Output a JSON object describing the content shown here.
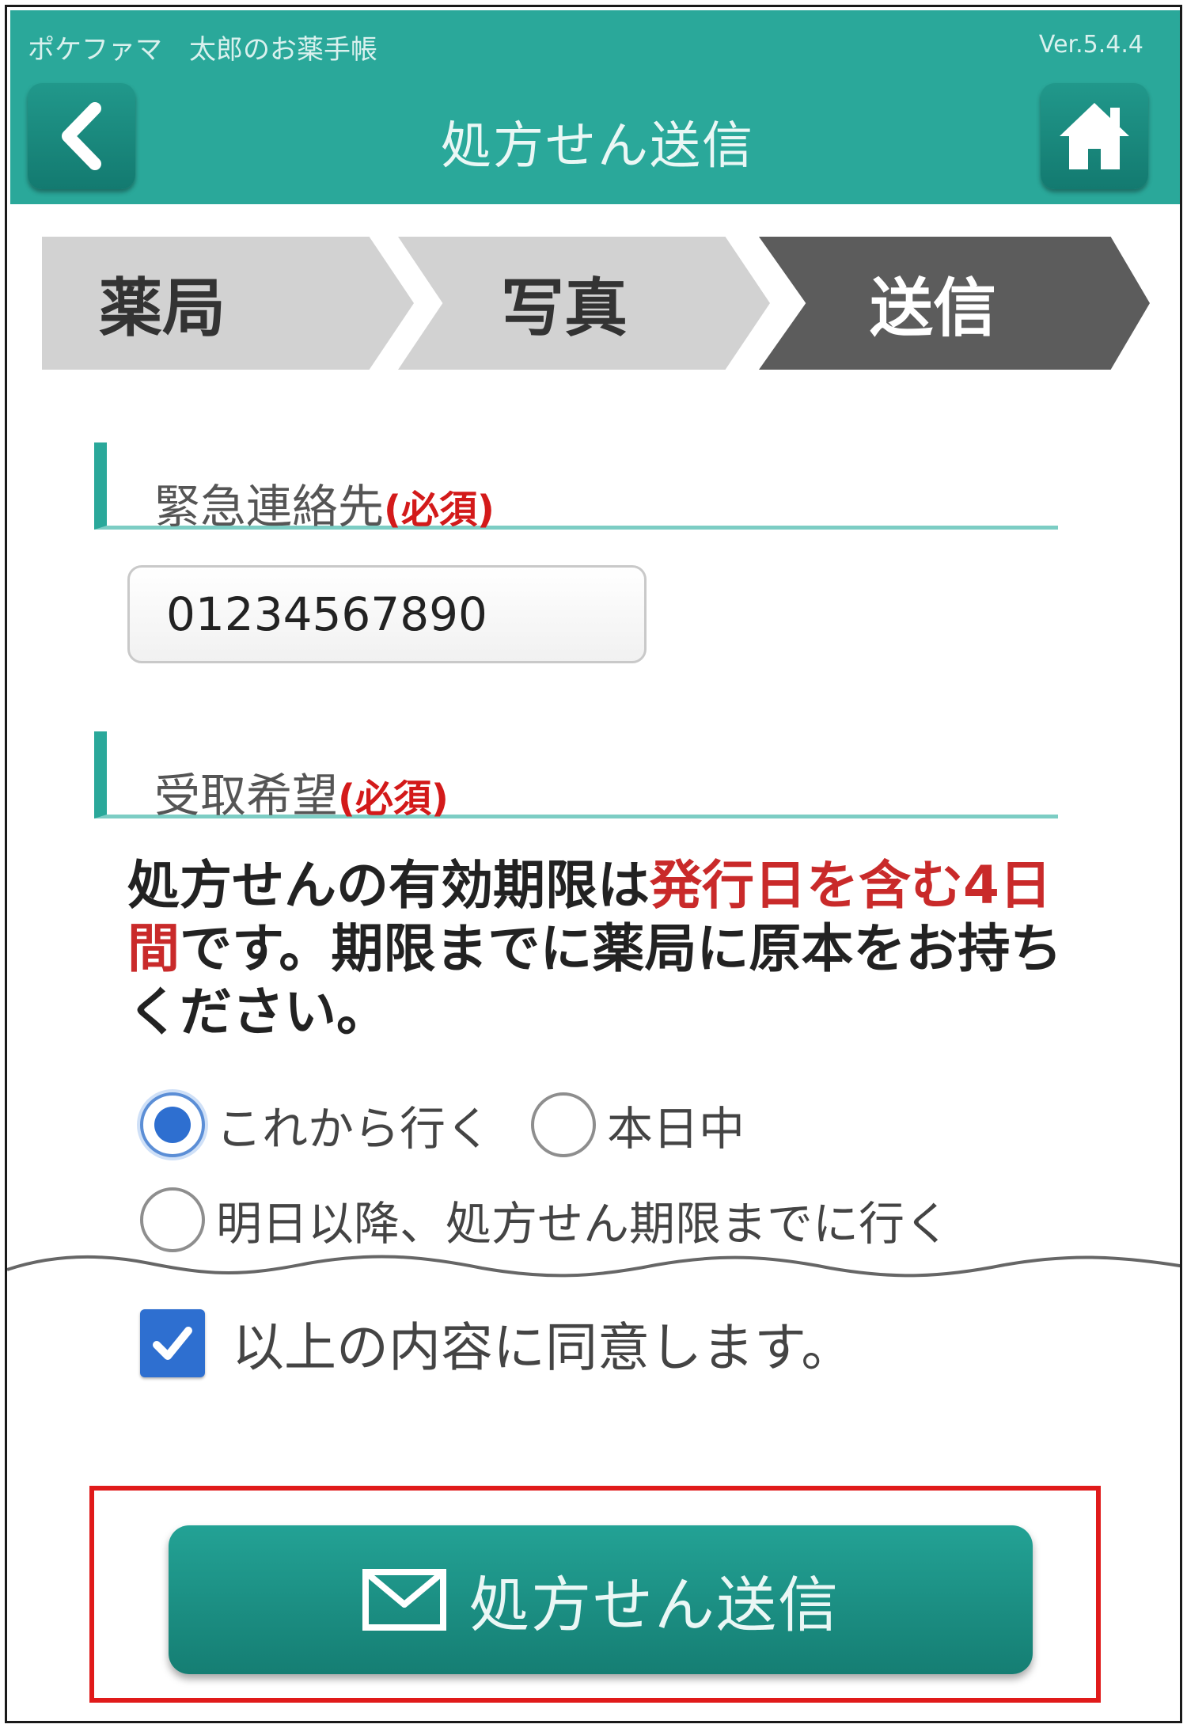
{
  "header": {
    "app_name": "ポケファマ　太郎のお薬手帳",
    "version": "Ver.5.4.4",
    "title": "処方せん送信",
    "back_icon": "chevron-left-icon",
    "home_icon": "home-icon"
  },
  "steps": [
    {
      "label": "薬局",
      "active": false
    },
    {
      "label": "写真",
      "active": false
    },
    {
      "label": "送信",
      "active": true
    }
  ],
  "emergency_contact": {
    "label": "緊急連絡先",
    "required": "(必須)",
    "value": "01234567890"
  },
  "pickup": {
    "label": "受取希望",
    "required": "(必須)",
    "notice_part1": "処方せんの有効期限は",
    "notice_red": "発行日を含む4日間",
    "notice_part2": "です。期限までに薬局に原本をお持ちください。",
    "options": [
      {
        "label": "これから行く",
        "checked": true
      },
      {
        "label": "本日中",
        "checked": false
      },
      {
        "label": "明日以降、処方せん期限までに行く",
        "checked": false
      }
    ]
  },
  "agreement": {
    "label": "以上の内容に同意します。",
    "checked": true
  },
  "submit": {
    "label": "処方せん送信",
    "icon": "mail-icon"
  },
  "colors": {
    "header_teal": "#2aa89a",
    "required_red": "#d31a1a",
    "radio_blue": "#2e6fd0",
    "highlight_red": "#e01a1a"
  }
}
